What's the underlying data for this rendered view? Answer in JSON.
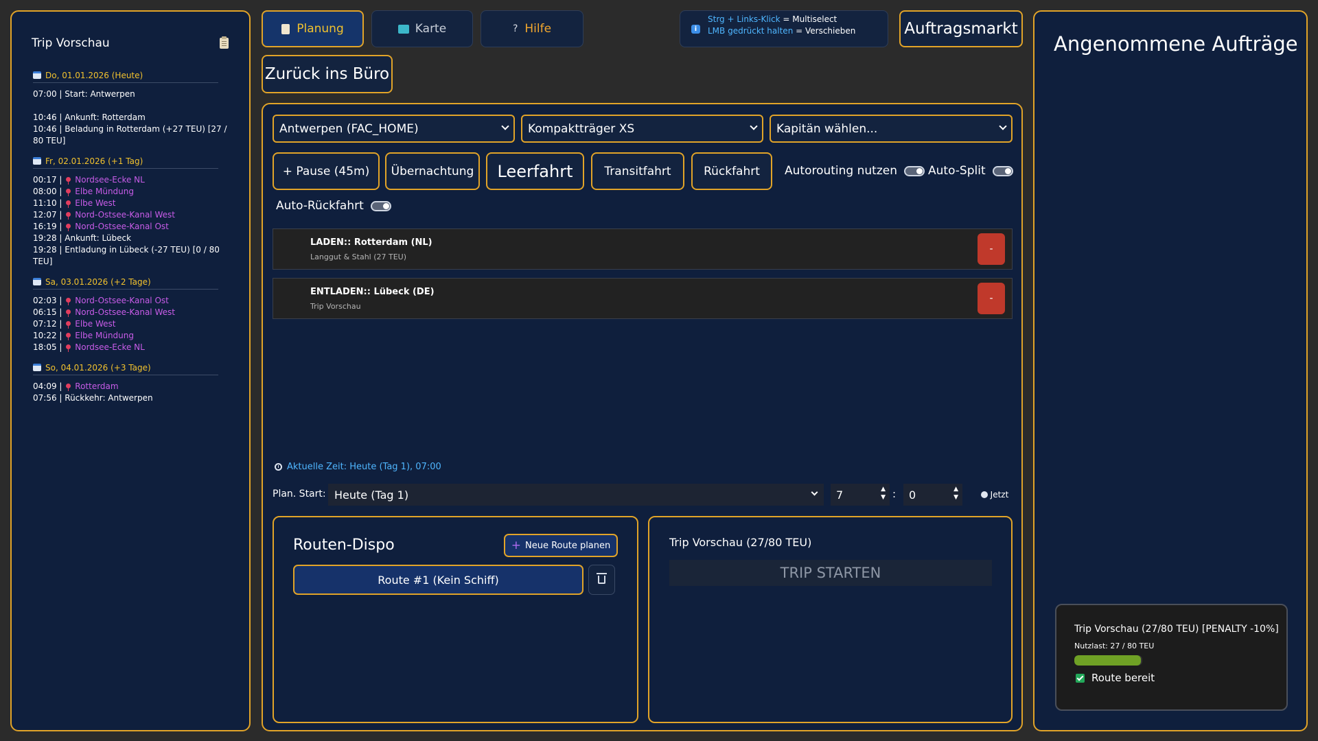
{
  "left": {
    "title": "Trip Vorschau",
    "days": [
      {
        "date": "Do, 01.01.2026 (Heute)",
        "entries": [
          {
            "time": "07:00",
            "text": "Start: Antwerpen",
            "waypoint": false
          },
          {
            "time": "10:46",
            "text": "Ankunft: Rotterdam",
            "waypoint": false
          },
          {
            "time": "10:46",
            "text": "Beladung in Rotterdam (+27 TEU) [27 / 80 TEU]",
            "waypoint": false
          }
        ]
      },
      {
        "date": "Fr, 02.01.2026 (+1 Tag)",
        "entries": [
          {
            "time": "00:17",
            "text": "Nordsee-Ecke NL",
            "waypoint": true
          },
          {
            "time": "08:00",
            "text": "Elbe Mündung",
            "waypoint": true
          },
          {
            "time": "11:10",
            "text": "Elbe West",
            "waypoint": true
          },
          {
            "time": "12:07",
            "text": "Nord-Ostsee-Kanal West",
            "waypoint": true
          },
          {
            "time": "16:19",
            "text": "Nord-Ostsee-Kanal Ost",
            "waypoint": true
          },
          {
            "time": "19:28",
            "text": "Ankunft: Lübeck",
            "waypoint": false
          },
          {
            "time": "19:28",
            "text": "Entladung in Lübeck (-27 TEU) [0 / 80 TEU]",
            "waypoint": false
          }
        ]
      },
      {
        "date": "Sa, 03.01.2026 (+2 Tage)",
        "entries": [
          {
            "time": "02:03",
            "text": "Nord-Ostsee-Kanal Ost",
            "waypoint": true
          },
          {
            "time": "06:15",
            "text": "Nord-Ostsee-Kanal West",
            "waypoint": true
          },
          {
            "time": "07:12",
            "text": "Elbe West",
            "waypoint": true
          },
          {
            "time": "10:22",
            "text": "Elbe Mündung",
            "waypoint": true
          },
          {
            "time": "18:05",
            "text": "Nordsee-Ecke NL",
            "waypoint": true
          }
        ]
      },
      {
        "date": "So, 04.01.2026 (+3 Tage)",
        "entries": [
          {
            "time": "04:09",
            "text": "Rotterdam",
            "waypoint": true
          },
          {
            "time": "07:56",
            "text": "Rückkehr: Antwerpen",
            "waypoint": false
          }
        ]
      }
    ]
  },
  "tabs": {
    "planung": "Planung",
    "karte": "Karte",
    "hilfe": "Hilfe"
  },
  "hint": {
    "line1_key": "Strg + Links-Klick",
    "line1_rest": " = Multiselect",
    "line2_key": "LMB gedrückt halten",
    "line2_rest": " = Verschieben"
  },
  "market_button": "Auftragsmarkt",
  "office_button": "Zurück ins Büro",
  "planning": {
    "port_select": "Antwerpen (FAC_HOME)",
    "ship_select": "Kompaktträger XS",
    "captain_select": "Kapitän wählen...",
    "buttons": {
      "pause": "+ Pause (45m)",
      "night": "Übernachtung",
      "empty": "Leerfahrt",
      "transit": "Transitfahrt",
      "return": "Rückfahrt"
    },
    "toggles": {
      "autorouting": "Autorouting nutzen",
      "autosplit": "Auto-Split",
      "autoreturn": "Auto-Rückfahrt"
    },
    "stops": [
      {
        "title": "LADEN:: Rotterdam (NL)",
        "sub": "Langgut & Stahl (27 TEU)",
        "remove": "-"
      },
      {
        "title": "ENTLADEN:: Lübeck (DE)",
        "sub": "Trip Vorschau",
        "remove": "-"
      }
    ],
    "current_time": "Aktuelle Zeit: Heute (Tag 1), 07:00",
    "plan_start_label": "Plan. Start:",
    "plan_start_day": "Heute (Tag 1)",
    "hour": "7",
    "colon": ":",
    "minute": "0",
    "now_button": "Jetzt"
  },
  "dispo": {
    "title": "Routen-Dispo",
    "new_route": "Neue Route planen",
    "route": "Route #1 (Kein Schiff)"
  },
  "trip": {
    "title": "Trip Vorschau (27/80 TEU)",
    "start": "TRIP STARTEN"
  },
  "right": {
    "title": "Angenommene Aufträge",
    "toast": {
      "title": "Trip Vorschau (27/80 TEU) [PENALTY -10%]",
      "load": "Nutzlast: 27 / 80 TEU",
      "load_fraction": 0.3375,
      "ready": "Route bereit"
    }
  },
  "colors": {
    "accent": "#e2a428",
    "panel": "#0f1f3d",
    "link": "#4fb6ff",
    "waypoint": "#c85ce8",
    "danger": "#c0392b",
    "progress": "#6fa125"
  }
}
